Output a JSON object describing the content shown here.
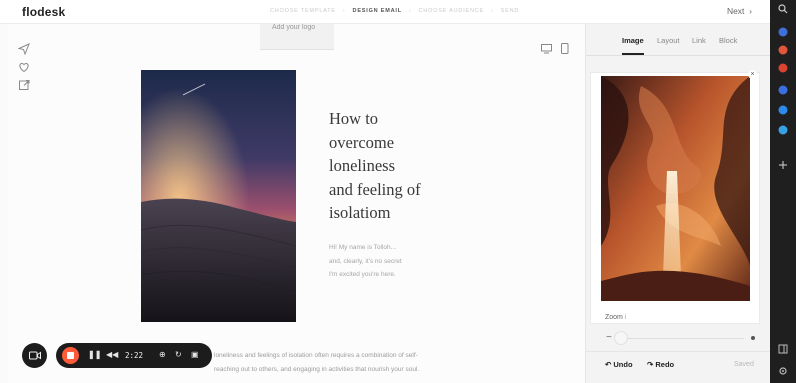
{
  "app": {
    "brand": "flodesk",
    "steps": [
      {
        "label": "CHOOSE TEMPLATE",
        "active": false
      },
      {
        "label": "DESIGN EMAIL",
        "active": true
      },
      {
        "label": "CHOOSE AUDIENCE",
        "active": false
      },
      {
        "label": "SEND",
        "active": false
      }
    ],
    "next_label": "Next",
    "logo_placeholder": "Add your logo"
  },
  "left_toolbar": {
    "icons": [
      "send-icon",
      "heart-icon",
      "external-link-icon"
    ]
  },
  "device_toggle": {
    "icons": [
      "desktop-icon",
      "mobile-icon"
    ]
  },
  "email": {
    "title_lines": [
      "How to",
      "overcome",
      "loneliness",
      "and feeling of",
      "isolatiom"
    ],
    "intro_lines": [
      "Hi! My name is Tolloh...",
      "and, clearly, it's no secret",
      "I'm excited you're here."
    ],
    "body_lines": [
      "loneliness and feelings of isolation often requires a combination of self-",
      "reaching out to others, and engaging in activities that nourish your soul."
    ]
  },
  "panel": {
    "tabs": [
      "Image",
      "Layout",
      "Link",
      "Block"
    ],
    "active_tab": "Image",
    "close_glyph": "×",
    "zoom_label": "Zoom",
    "zoom_info_glyph": "i",
    "zoom_level": 0.0,
    "undo_label": "Undo",
    "redo_label": "Redo",
    "saved_label": "Saved"
  },
  "recorder": {
    "time": "2:22",
    "icons": [
      "camera-icon",
      "stop-icon",
      "pause-icon",
      "rewind-icon",
      "target-icon",
      "restart-icon",
      "trash-icon"
    ],
    "stop_color": "#ff5b3a"
  },
  "browser_strip": {
    "icons": [
      "search-icon",
      "extension-icon",
      "extension-icon",
      "extension-icon",
      "extension-icon",
      "extension-icon",
      "add-icon",
      "sidebar-icon",
      "settings-icon"
    ]
  }
}
